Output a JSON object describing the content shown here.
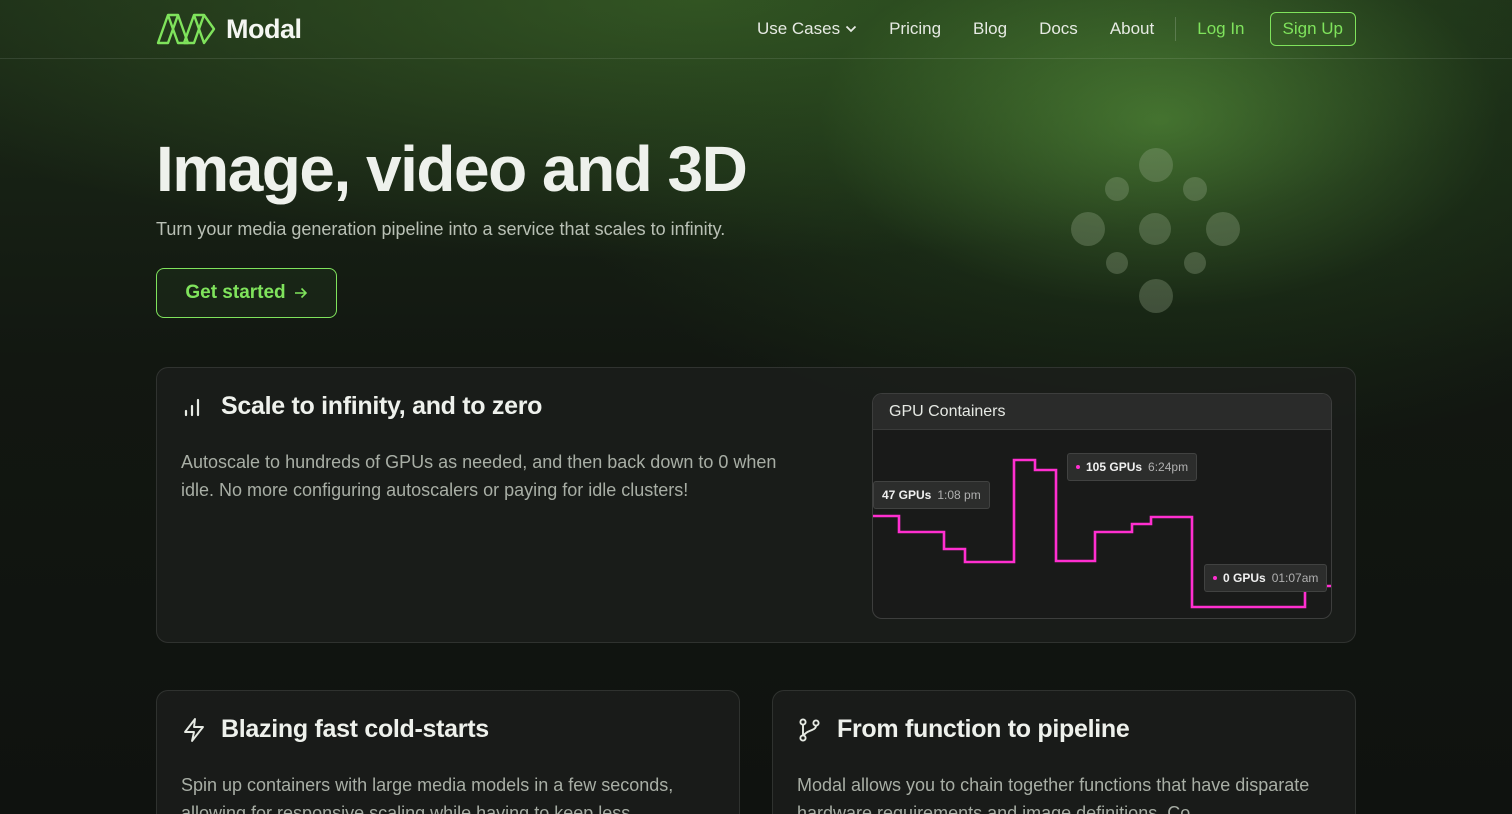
{
  "brand": {
    "name": "Modal",
    "accent": "#7fe35c"
  },
  "nav": {
    "use_cases": "Use Cases",
    "pricing": "Pricing",
    "blog": "Blog",
    "docs": "Docs",
    "about": "About",
    "login": "Log In",
    "signup": "Sign Up"
  },
  "hero": {
    "title": "Image, video and 3D",
    "subtitle": "Turn your media generation pipeline into a service that scales to infinity.",
    "cta": "Get started"
  },
  "features": {
    "scale": {
      "icon": "bar-chart-icon",
      "title": "Scale to infinity, and to zero",
      "body": "Autoscale to hundreds of GPUs as needed, and then back down to 0 when idle. No more configuring autoscalers or paying for idle clusters!"
    },
    "cold_start": {
      "icon": "lightning-icon",
      "title": "Blazing fast cold-starts",
      "body": "Spin up containers with large media models in a few seconds, allowing for responsive scaling while having to keep less"
    },
    "pipeline": {
      "icon": "git-branch-icon",
      "title": "From function to pipeline",
      "body": "Modal allows you to chain together functions that have disparate hardware requirements and image definitions. Co"
    }
  },
  "gpu_panel": {
    "title": "GPU Containers",
    "line_color": "#ff2fd0",
    "tooltips": [
      {
        "value": "47 GPUs",
        "time": "1:08 pm"
      },
      {
        "value": "105 GPUs",
        "time": "6:24pm"
      },
      {
        "value": "0 GPUs",
        "time": "01:07am"
      }
    ]
  }
}
